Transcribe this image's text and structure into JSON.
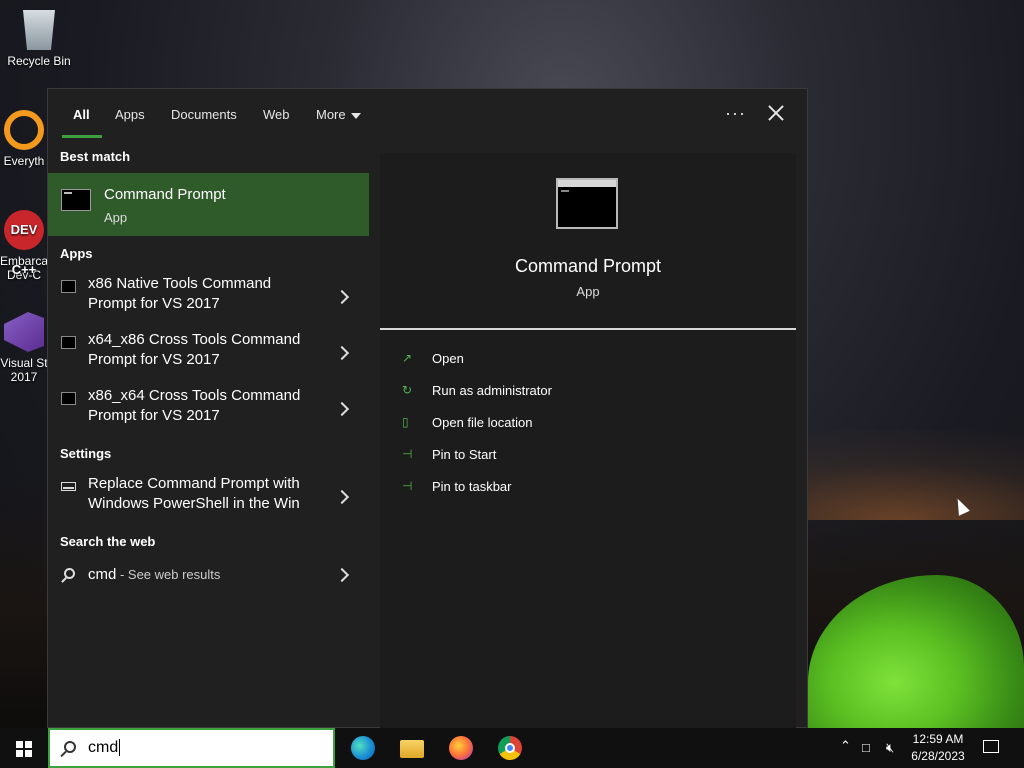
{
  "desktop": {
    "icons": [
      {
        "label": "Recycle Bin"
      },
      {
        "label": "Everyth"
      },
      {
        "label": "Embarca Dev-C"
      },
      {
        "label": "Visual St 2017"
      }
    ],
    "devcpp_text": "DEV C++"
  },
  "search_panel": {
    "tabs": [
      "All",
      "Apps",
      "Documents",
      "Web",
      "More"
    ],
    "options_label": "···",
    "best_match_heading": "Best match",
    "best_match": {
      "title": "Command Prompt",
      "subtitle": "App"
    },
    "apps_heading": "Apps",
    "apps": [
      {
        "line1": "x86 Native Tools Command",
        "line2": "Prompt for VS 2017"
      },
      {
        "line1": "x64_x86 Cross Tools Command",
        "line2": "Prompt for VS 2017"
      },
      {
        "line1": "x86_x64 Cross Tools Command",
        "line2": "Prompt for VS 2017"
      }
    ],
    "settings_heading": "Settings",
    "settings_item": {
      "line1": "Replace Command Prompt with",
      "line2": "Windows PowerShell in the Win"
    },
    "web_heading": "Search the web",
    "web_item": {
      "query": "cmd",
      "suffix": " - See web results"
    },
    "preview": {
      "title": "Command Prompt",
      "subtitle": "App",
      "actions": [
        {
          "label": "Open",
          "icon": "open-icon"
        },
        {
          "label": "Run as administrator",
          "icon": "shield-icon"
        },
        {
          "label": "Open file location",
          "icon": "file-location-icon"
        },
        {
          "label": "Pin to Start",
          "icon": "pin-icon"
        },
        {
          "label": "Pin to taskbar",
          "icon": "pin-icon"
        }
      ]
    }
  },
  "taskbar": {
    "search_value": "cmd",
    "clock_time": "12:59 AM",
    "clock_date": "6/28/2023",
    "pinned": [
      "edge-icon",
      "file-explorer-icon",
      "firefox-icon",
      "chrome-icon"
    ]
  },
  "colors": {
    "accent": "#3ea03e",
    "best_match_bg": "#2f5a2a",
    "panel_bg": "#202020"
  }
}
